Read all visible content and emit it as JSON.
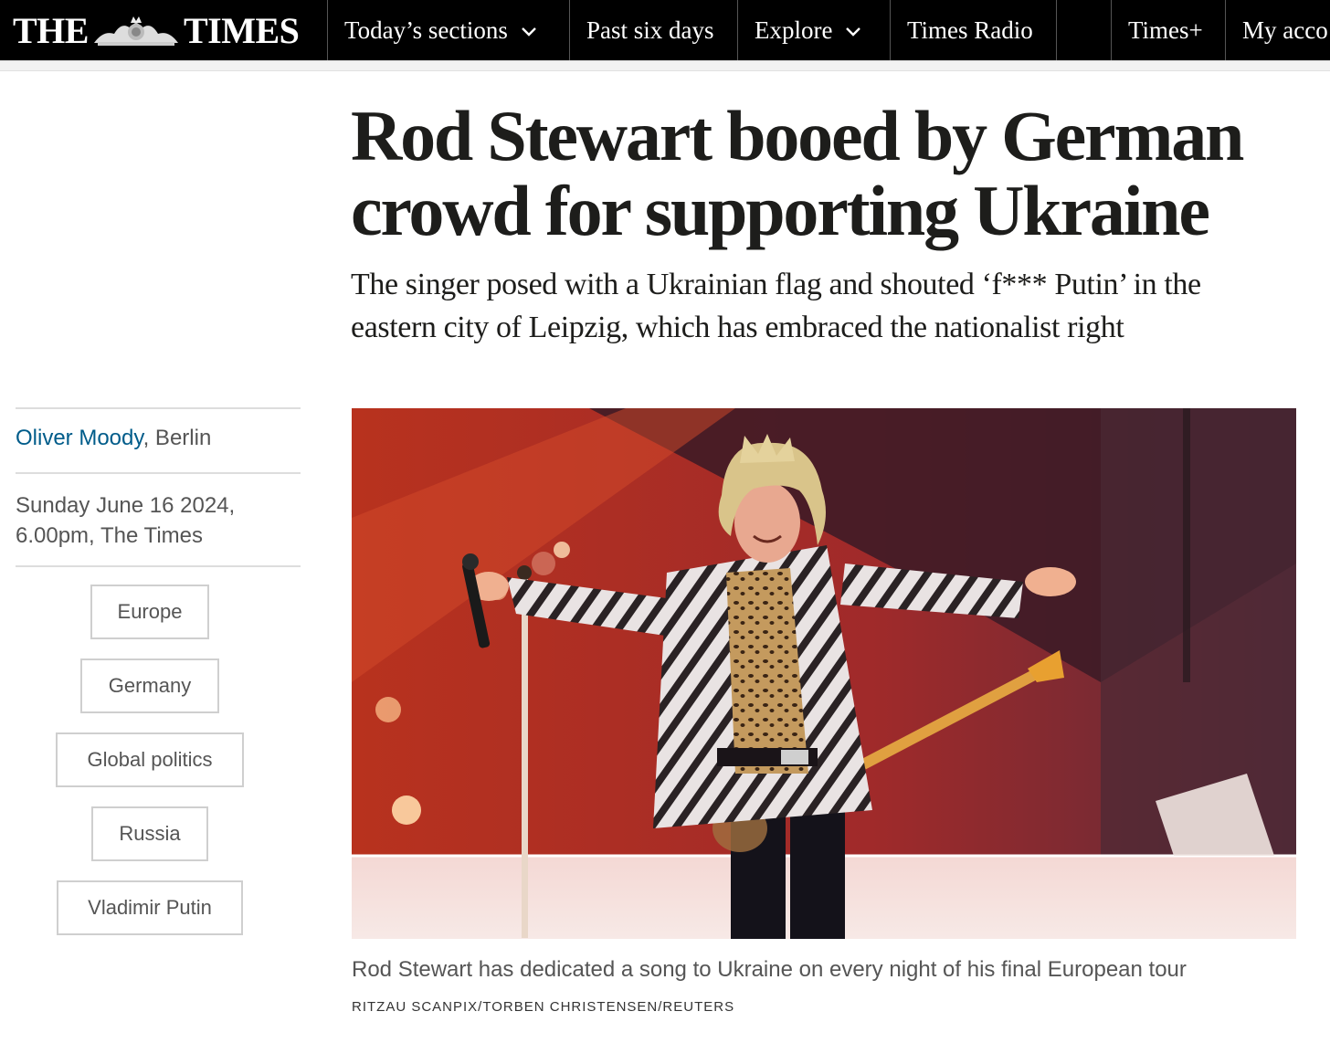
{
  "nav": {
    "logo_left": "THE",
    "logo_right": "TIMES",
    "items": [
      {
        "label": "Today’s sections",
        "dropdown": true
      },
      {
        "label": "Past six days",
        "dropdown": false
      },
      {
        "label": "Explore",
        "dropdown": true
      },
      {
        "label": "Times Radio",
        "dropdown": false
      },
      {
        "label": "Times+",
        "dropdown": false
      },
      {
        "label": "My acco",
        "dropdown": false
      }
    ]
  },
  "article": {
    "headline": "Rod Stewart booed by German crowd for supporting Ukraine",
    "standfirst": "The singer posed with a Ukrainian flag and shouted ‘f*** Putin’ in the eastern city of Leipzig, which has embraced the nationalist right",
    "author": "Oliver Moody",
    "location": ", Berlin",
    "date_line1": "Sunday June 16 2024,",
    "date_line2": "6.00pm, The Times",
    "tags": [
      "Europe",
      "Germany",
      "Global politics",
      "Russia",
      "Vladimir Putin"
    ],
    "caption": "Rod Stewart has dedicated a song to Ukraine on every night of his final European tour",
    "credit": "RITZAU SCANPIX/TORBEN CHRISTENSEN/REUTERS"
  },
  "colors": {
    "nav_bg": "#000000",
    "link": "#005c8a",
    "text": "#1d1d1b"
  }
}
